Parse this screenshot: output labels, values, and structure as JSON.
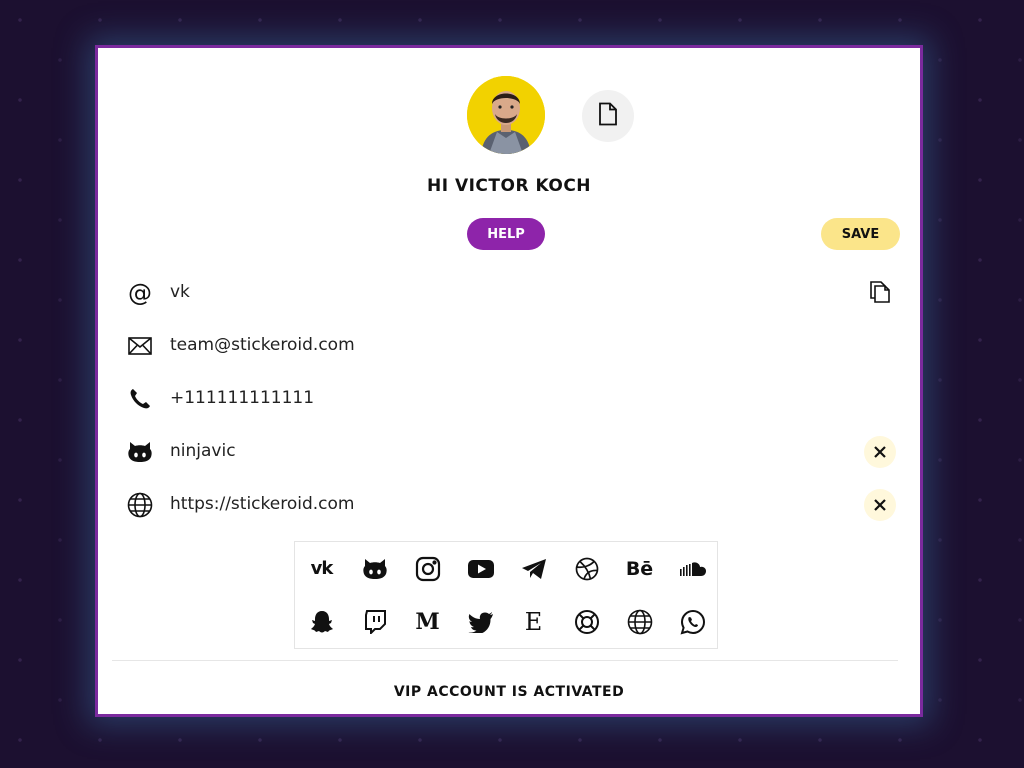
{
  "header": {
    "greeting": "HI VICTOR KOCH",
    "help_label": "HELP",
    "save_label": "SAVE"
  },
  "fields": [
    {
      "icon": "at-icon",
      "value": "vk",
      "action": "copy-icon"
    },
    {
      "icon": "mail-icon",
      "value": "team@stickeroid.com"
    },
    {
      "icon": "phone-icon",
      "value": "+111111111111"
    },
    {
      "icon": "github-icon",
      "value": "ninjavic",
      "action": "remove-icon"
    },
    {
      "icon": "globe-icon",
      "value": "https://stickeroid.com",
      "action": "remove-icon"
    }
  ],
  "social_grid": [
    "vk",
    "github",
    "instagram",
    "youtube",
    "telegram",
    "dribbble",
    "behance",
    "soundcloud",
    "snapchat",
    "twitch",
    "medium",
    "twitter",
    "etsy",
    "lifebuoy",
    "website",
    "whatsapp"
  ],
  "grid_text": {
    "behance": "Bē",
    "medium": "M",
    "etsy": "E",
    "vk": "vk"
  },
  "footer": {
    "status": "VIP ACCOUNT IS ACTIVATED"
  },
  "colors": {
    "accent": "#8e24aa",
    "save": "#fbe58a",
    "frame": "#7b2a9e",
    "background": "#1c1030"
  }
}
